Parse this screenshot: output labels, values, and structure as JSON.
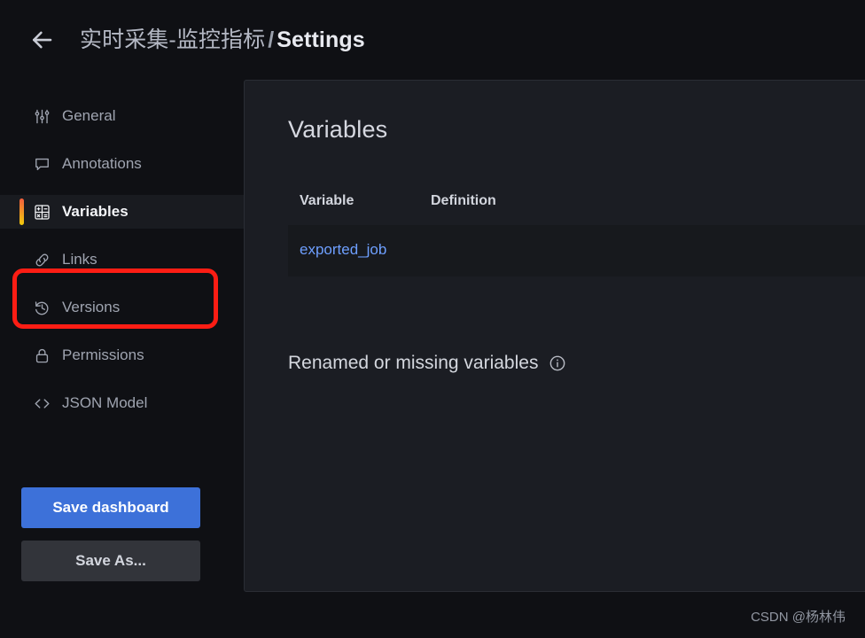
{
  "header": {
    "back_icon": "arrow-left-icon",
    "breadcrumb": {
      "dashboard": "实时采集-监控指标",
      "separator": "/",
      "current": "Settings"
    }
  },
  "sidebar": {
    "items": [
      {
        "label": "General",
        "icon": "sliders-icon",
        "active": false
      },
      {
        "label": "Annotations",
        "icon": "comment-icon",
        "active": false
      },
      {
        "label": "Variables",
        "icon": "calculator-icon",
        "active": true
      },
      {
        "label": "Links",
        "icon": "link-icon",
        "active": false
      },
      {
        "label": "Versions",
        "icon": "history-icon",
        "active": false
      },
      {
        "label": "Permissions",
        "icon": "lock-icon",
        "active": false
      },
      {
        "label": "JSON Model",
        "icon": "code-brackets-icon",
        "active": false
      }
    ],
    "actions": {
      "save_dashboard": "Save dashboard",
      "save_as": "Save As..."
    }
  },
  "main": {
    "title": "Variables",
    "table": {
      "columns": [
        "Variable",
        "Definition"
      ],
      "rows": [
        {
          "variable": "exported_job",
          "definition": ""
        }
      ]
    },
    "renamed_section": {
      "title": "Renamed or missing variables",
      "info_icon": "info-circle-icon"
    }
  },
  "watermark": "CSDN @杨林伟",
  "colors": {
    "page_background": "#0f1014",
    "panel_background": "#1b1d23",
    "row_background": "#17191d",
    "primary_button": "#3d71d9",
    "secondary_button": "#32343a",
    "link": "#6e9fff",
    "active_bar_start": "#f55f3e",
    "active_bar_end": "#f2cc0c",
    "annotation": "#fc1d14"
  }
}
